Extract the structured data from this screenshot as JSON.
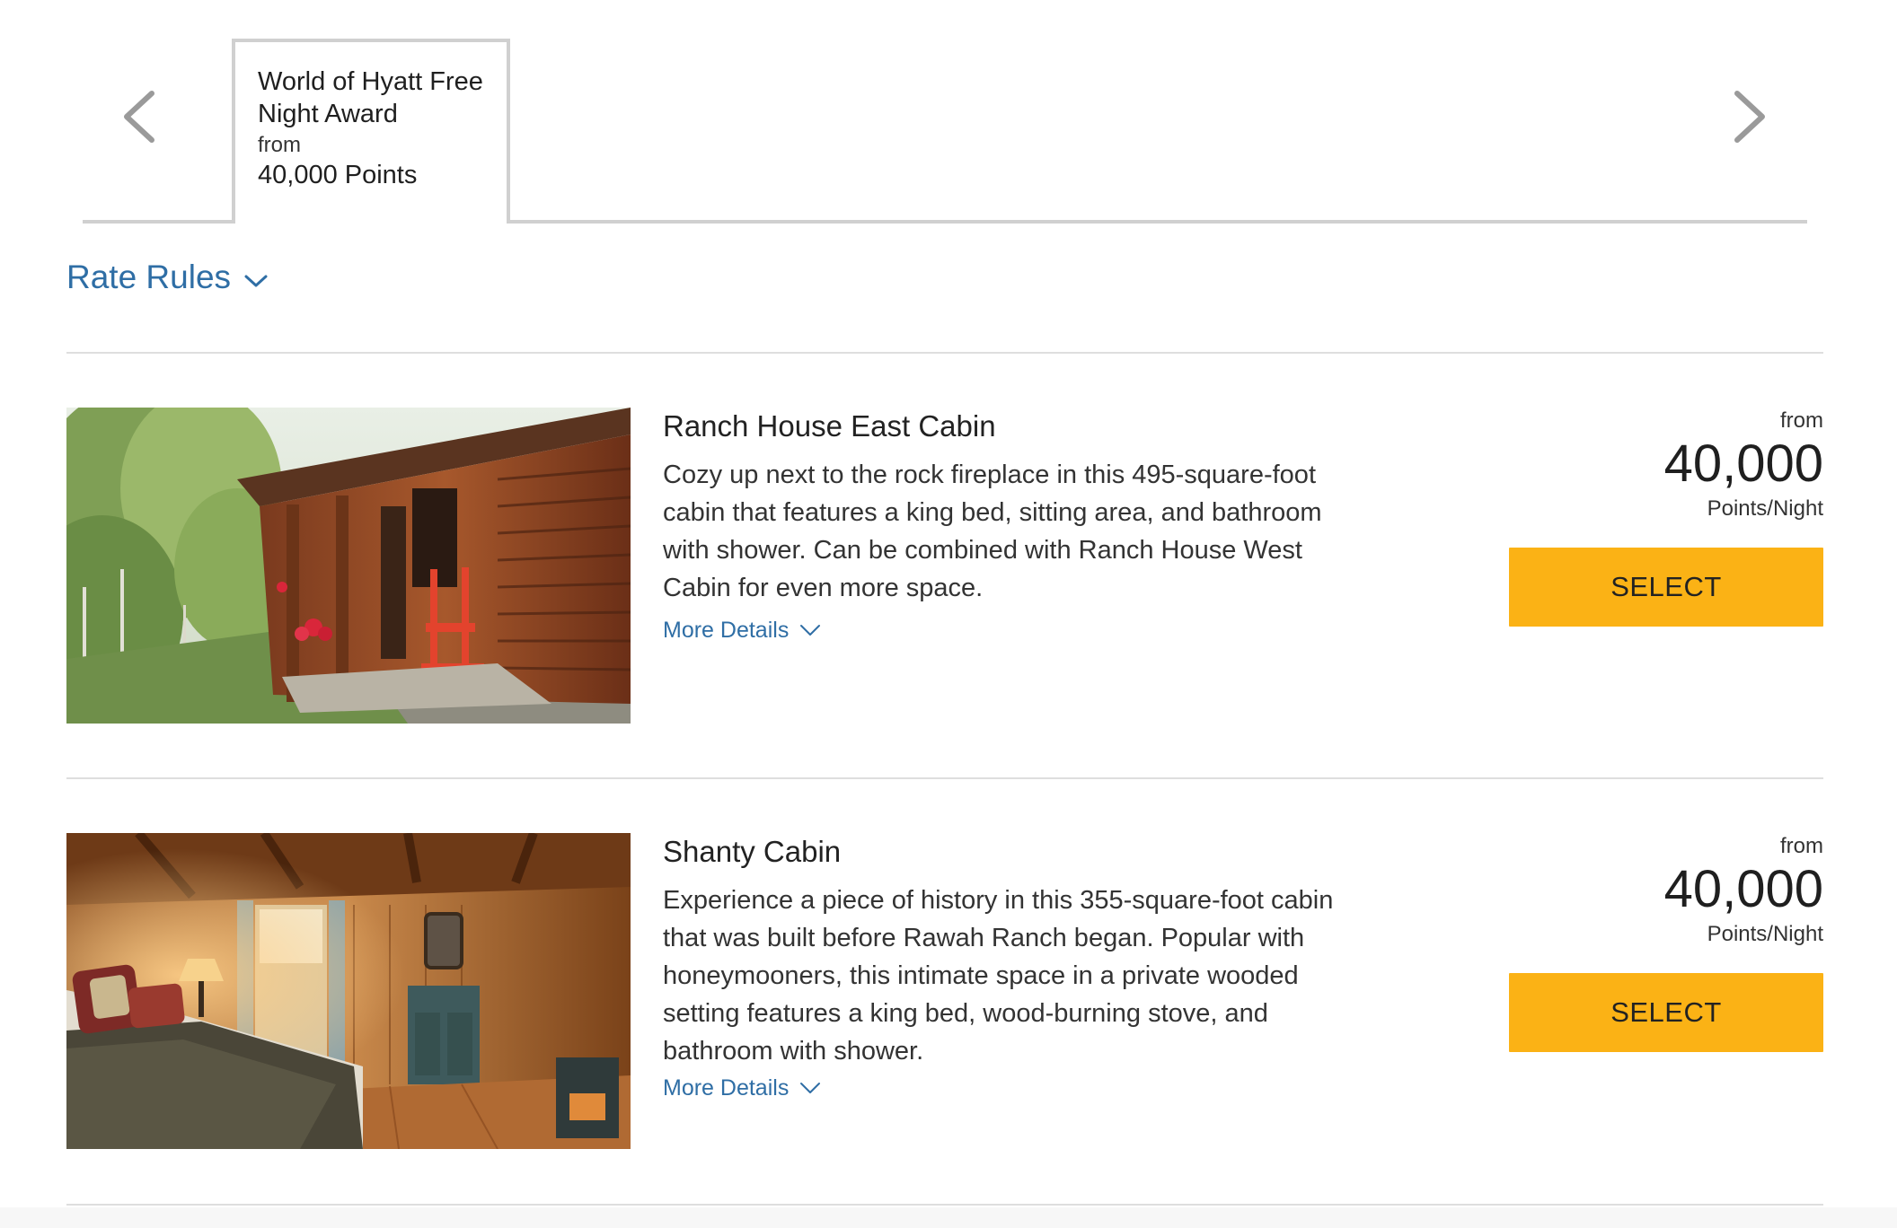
{
  "rate_tab": {
    "title": "World of Hyatt Free Night Award",
    "from_label": "from",
    "points": "40,000 Points"
  },
  "nav": {
    "prev_icon": "chevron-left-icon",
    "next_icon": "chevron-right-icon"
  },
  "rate_rules": {
    "label": "Rate Rules",
    "icon": "chevron-down-icon"
  },
  "colors": {
    "link_blue": "#2f6ea5",
    "select_yellow": "#fbb215",
    "divider_gray": "#dedede"
  },
  "rooms": [
    {
      "name": "Ranch House East Cabin",
      "description": "Cozy up next to the rock fireplace in this 495-square-foot cabin that features a king bed, sitting area, and bathroom with shower. Can be combined with Ranch House West Cabin for even more space.",
      "more_details": "More Details",
      "from_label": "from",
      "price": "40,000",
      "unit": "Points/Night",
      "select_label": "SELECT"
    },
    {
      "name": "Shanty Cabin",
      "description": "Experience a piece of history in this 355-square-foot cabin that was built before Rawah Ranch began. Popular with honeymooners, this intimate space in a private wooded setting features a king bed, wood-burning stove, and bathroom with shower.",
      "more_details": "More Details",
      "from_label": "from",
      "price": "40,000",
      "unit": "Points/Night",
      "select_label": "SELECT"
    }
  ]
}
